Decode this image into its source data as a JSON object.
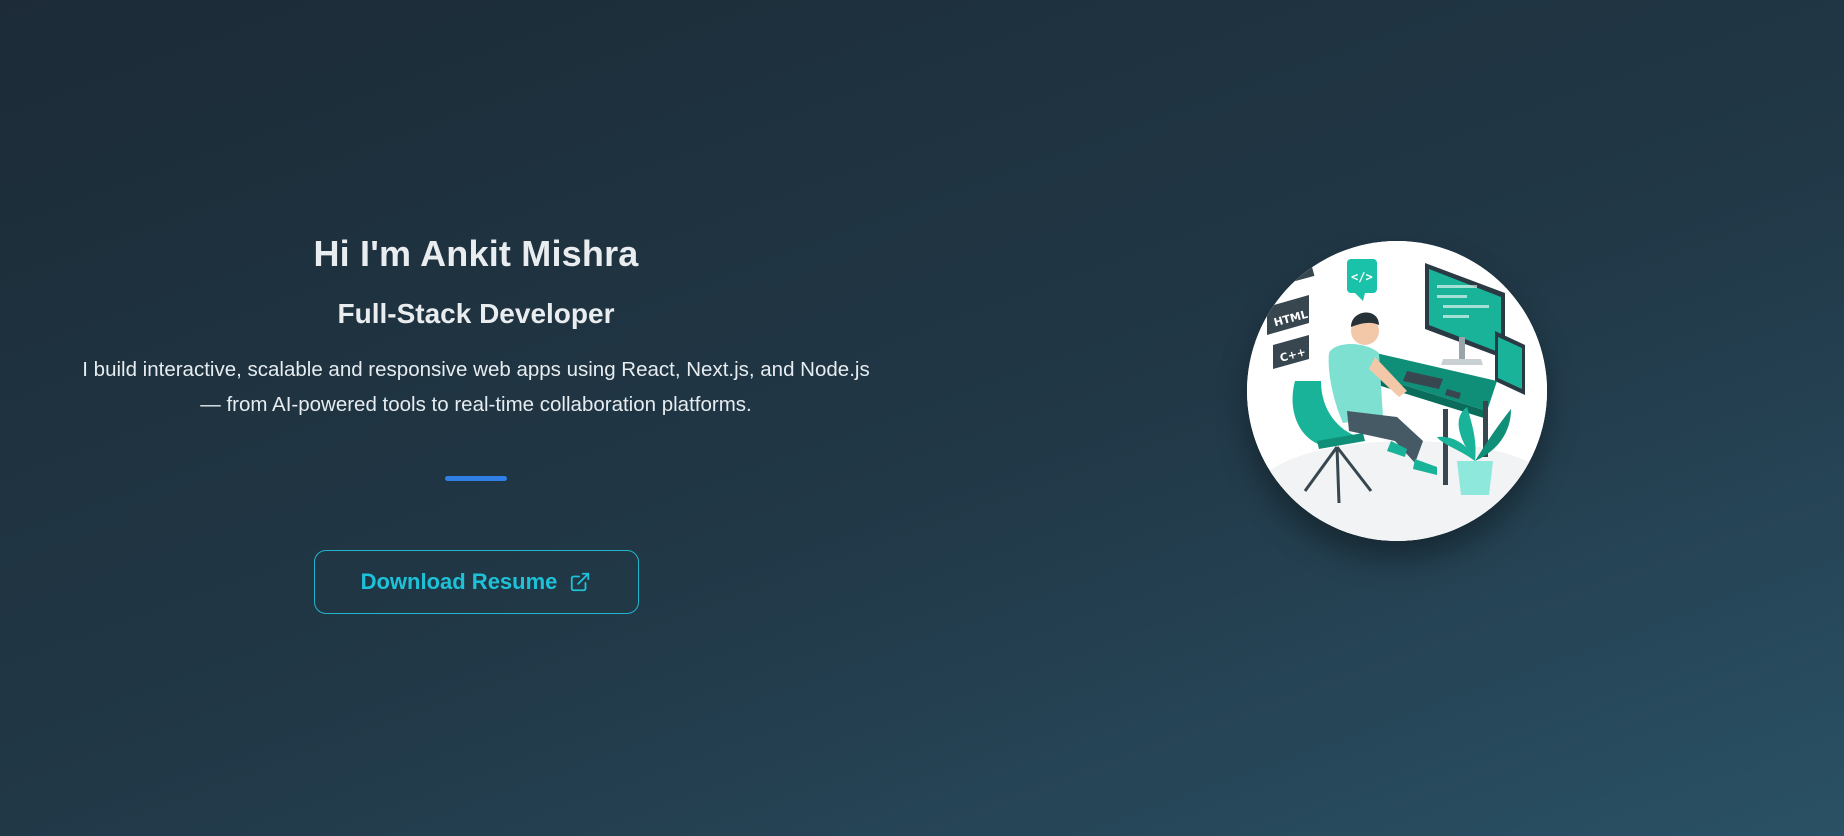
{
  "hero": {
    "title": "Hi I'm Ankit Mishra",
    "subtitle": "Full-Stack Developer",
    "description": "I build interactive, scalable and responsive web apps using React, Next.js, and Node.js — from AI-powered tools to real-time collaboration platforms.",
    "resume_label": "Download Resume",
    "resume_icon": "external-link-icon"
  },
  "illustration": {
    "tags": [
      "HTML",
      "C++",
      "</>"
    ],
    "icon": "developer-at-desk-illustration"
  },
  "colors": {
    "accent": "#1ec2d8",
    "divider": "#2f7fe6",
    "illustration_green": "#19b39a"
  }
}
